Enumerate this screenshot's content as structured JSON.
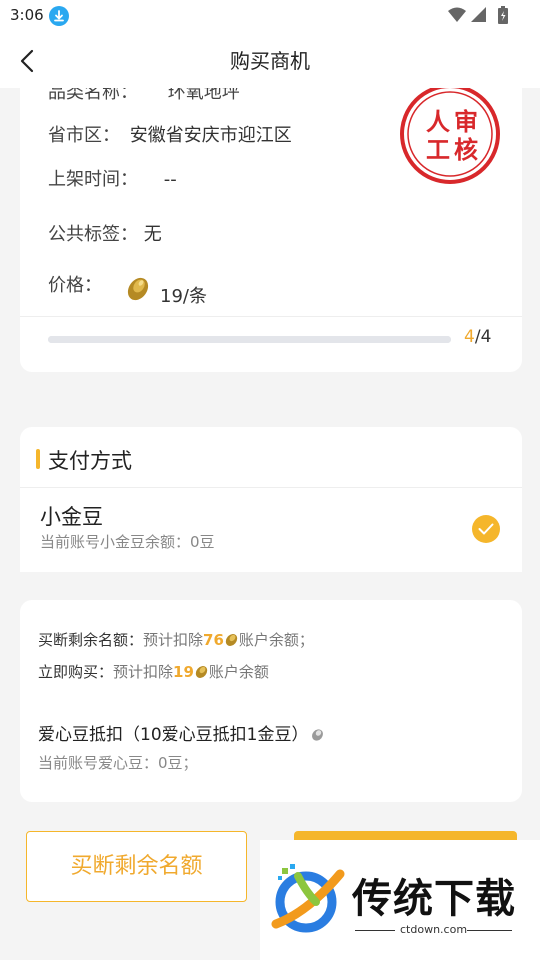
{
  "status_bar": {
    "time": "3:06",
    "icons": [
      "download-icon",
      "wifi-icon",
      "signal-icon",
      "battery-icon"
    ]
  },
  "nav": {
    "title": "购买商机",
    "back_icon": "chevron-left-icon"
  },
  "info": {
    "category_label": "品类名称：",
    "category_value": "环氧地坪",
    "region_label": "省市区：",
    "region_value": "安徽省安庆市迎江区",
    "time_label": "上架时间：",
    "time_value": "--",
    "tag_label": "公共标签：",
    "tag_value": "无",
    "price_label": "价格：",
    "price_value": "19/条",
    "stamp": {
      "text": "人审工核",
      "color": "#d8282b"
    },
    "progress": {
      "current": "4",
      "separator": "/",
      "total": "4"
    }
  },
  "payment": {
    "section_title": "支付方式",
    "method_name": "小金豆",
    "method_balance": "当前账号小金豆余额：0豆",
    "selected": true
  },
  "deduct": {
    "buyout_label": "买断剩余名额：",
    "buyout_pre": "预计扣除",
    "buyout_amount": "76",
    "buyout_post": "账户余额；",
    "buy_label": "立即购买：",
    "buy_pre": "预计扣除",
    "buy_amount": "19",
    "buy_post": "账户余额",
    "love_title": "爱心豆抵扣（10爱心豆抵扣1金豆）",
    "love_balance": "当前账号爱心豆：0豆；"
  },
  "buttons": {
    "buyout": "买断剩余名额"
  },
  "watermark": {
    "text": "传统下载",
    "url": "ctdown.com"
  },
  "colors": {
    "accent": "#f5b62b",
    "highlight_text": "#f0a92e",
    "download_badge": "#2aa8f0"
  }
}
